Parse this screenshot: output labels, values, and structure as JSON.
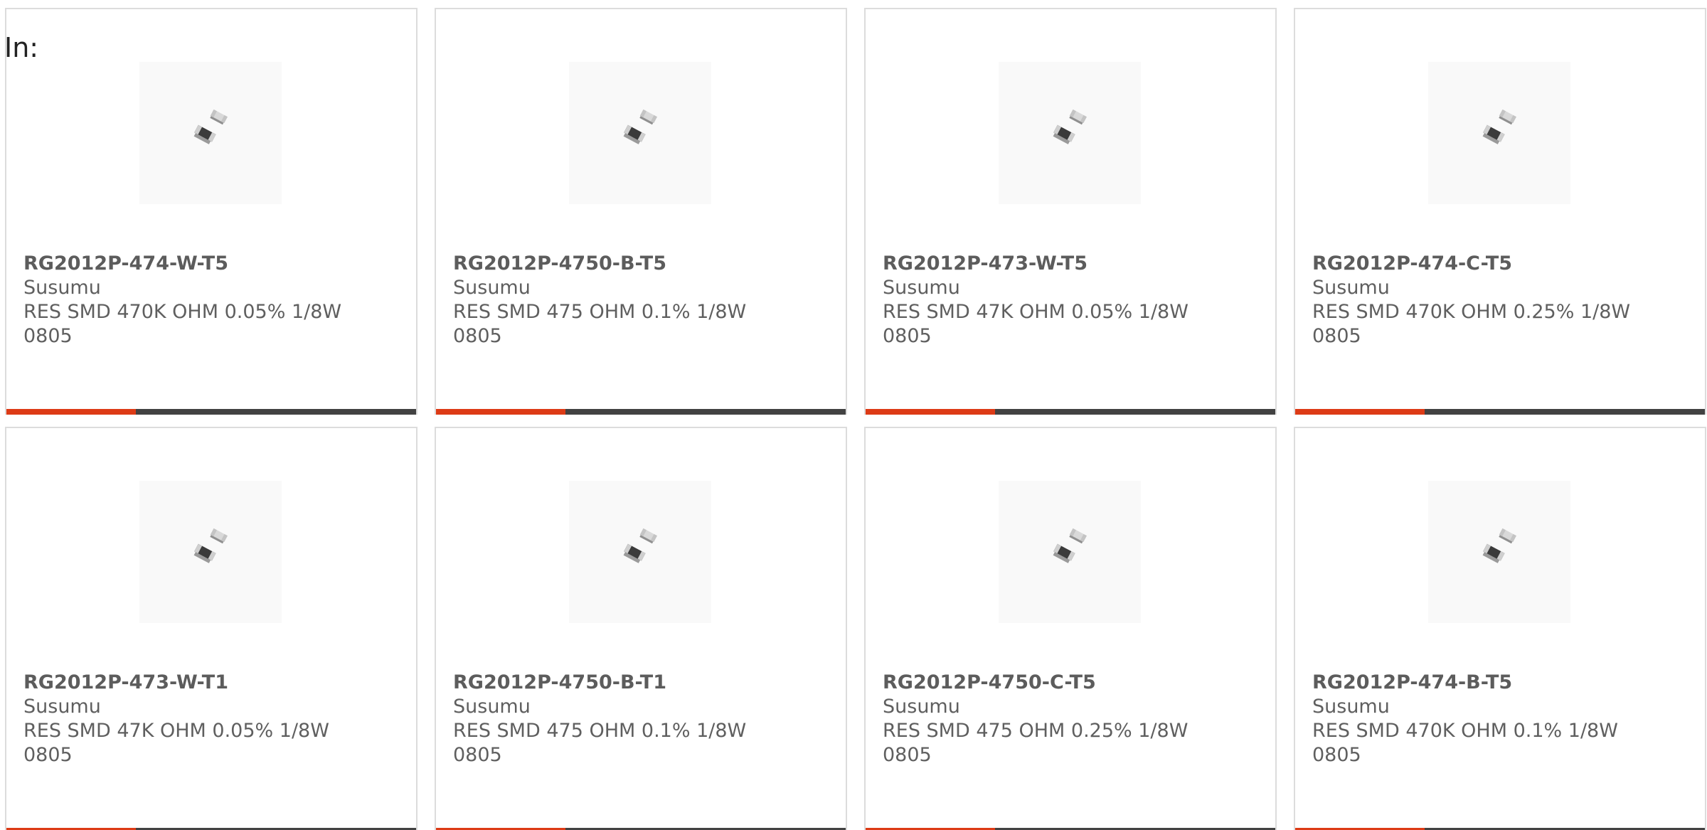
{
  "header": {
    "in_label": "In:"
  },
  "colors": {
    "accent": "#dd3b16",
    "bar_dark": "#424242",
    "card_border": "#dcdcdc",
    "text": "#5f5f5f"
  },
  "icons": {
    "product_image": "smd-resistor-image"
  },
  "products": [
    {
      "part_number": "RG2012P-474-W-T5",
      "manufacturer": "Susumu",
      "description": "RES SMD 470K OHM 0.05% 1/8W 0805"
    },
    {
      "part_number": "RG2012P-4750-B-T5",
      "manufacturer": "Susumu",
      "description": "RES SMD 475 OHM 0.1% 1/8W 0805"
    },
    {
      "part_number": "RG2012P-473-W-T5",
      "manufacturer": "Susumu",
      "description": "RES SMD 47K OHM 0.05% 1/8W 0805"
    },
    {
      "part_number": "RG2012P-474-C-T5",
      "manufacturer": "Susumu",
      "description": "RES SMD 470K OHM 0.25% 1/8W 0805"
    },
    {
      "part_number": "RG2012P-473-W-T1",
      "manufacturer": "Susumu",
      "description": "RES SMD 47K OHM 0.05% 1/8W 0805"
    },
    {
      "part_number": "RG2012P-4750-B-T1",
      "manufacturer": "Susumu",
      "description": "RES SMD 475 OHM 0.1% 1/8W 0805"
    },
    {
      "part_number": "RG2012P-4750-C-T5",
      "manufacturer": "Susumu",
      "description": "RES SMD 475 OHM 0.25% 1/8W 0805"
    },
    {
      "part_number": "RG2012P-474-B-T5",
      "manufacturer": "Susumu",
      "description": "RES SMD 470K OHM 0.1% 1/8W 0805"
    }
  ]
}
